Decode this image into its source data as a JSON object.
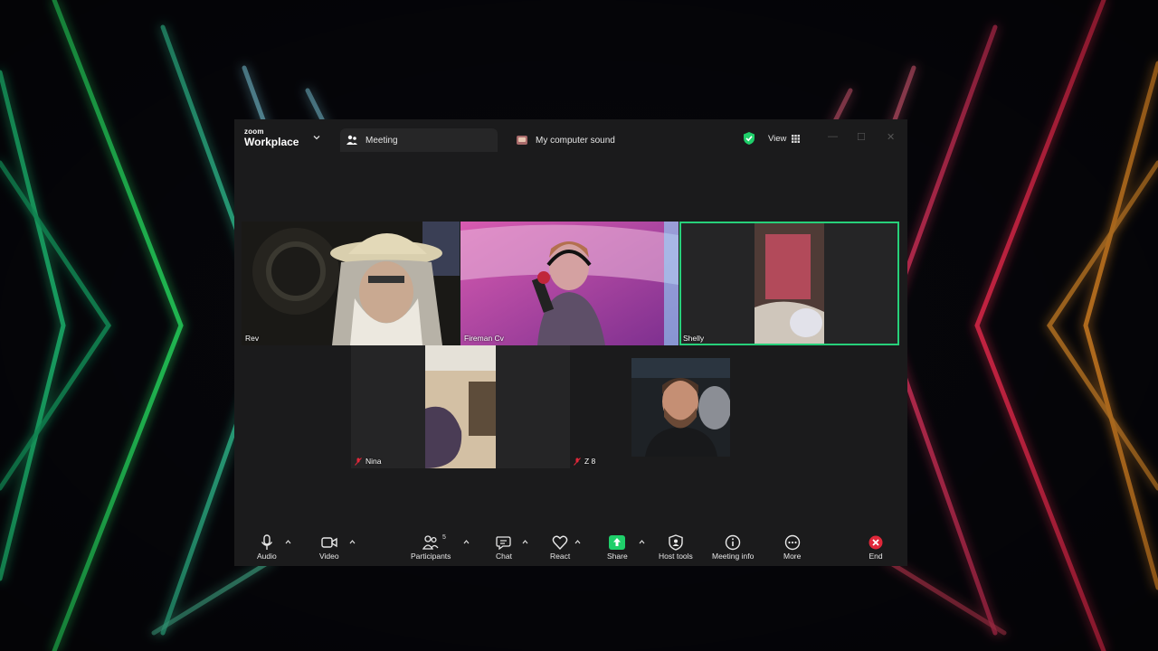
{
  "window": {
    "brand_small": "zoom",
    "brand": "Workplace",
    "tabs": [
      {
        "label": "Meeting",
        "icon": "participants-icon"
      },
      {
        "label": "My computer sound",
        "icon": "app-icon"
      }
    ],
    "view_label": "View"
  },
  "participants": [
    {
      "name": "Rev",
      "muted": false,
      "active_speaker": false
    },
    {
      "name": "Fireman Cv",
      "muted": false,
      "active_speaker": false
    },
    {
      "name": "Shelly",
      "muted": false,
      "active_speaker": true
    },
    {
      "name": "Nina",
      "muted": true,
      "active_speaker": false
    },
    {
      "name": "Z 8",
      "muted": true,
      "active_speaker": false
    },
    {
      "name": "",
      "muted": false,
      "active_speaker": false
    }
  ],
  "toolbar": {
    "audio": "Audio",
    "video": "Video",
    "participants": "Participants",
    "participants_count": "5",
    "chat": "Chat",
    "react": "React",
    "share": "Share",
    "host_tools": "Host tools",
    "meeting_info": "Meeting info",
    "more": "More",
    "end": "End"
  },
  "colors": {
    "accent_green": "#27d07a",
    "share_green": "#1fcf6a",
    "end_red": "#e0283a",
    "window_bg": "#1b1b1c"
  }
}
